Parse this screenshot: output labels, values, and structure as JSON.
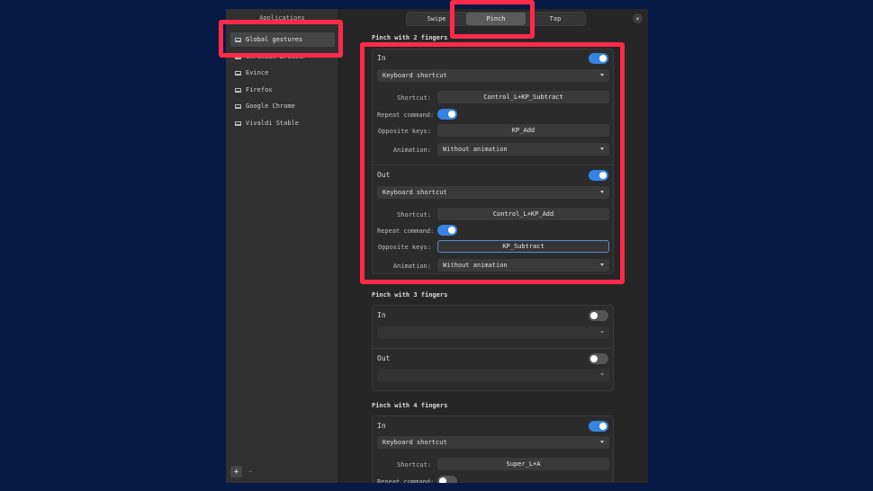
{
  "sidebar": {
    "title": "Applications",
    "items": [
      {
        "label": "Global gestures",
        "selected": true
      },
      {
        "label": "Chromium Browser",
        "selected": false
      },
      {
        "label": "Evince",
        "selected": false
      },
      {
        "label": "Firefox",
        "selected": false
      },
      {
        "label": "Google Chrome",
        "selected": false
      },
      {
        "label": "Vivaldi Stable",
        "selected": false
      }
    ],
    "add_label": "+",
    "remove_label": "−"
  },
  "tabs": [
    {
      "label": "Swipe",
      "active": false
    },
    {
      "label": "Pinch",
      "active": true
    },
    {
      "label": "Tap",
      "active": false
    }
  ],
  "close_label": "×",
  "labels": {
    "shortcut": "Shortcut:",
    "repeat": "Repeat command:",
    "opposite": "Opposite keys:",
    "animation": "Animation:"
  },
  "sections": [
    {
      "title": "Pinch with 2 fingers",
      "in": {
        "label": "In",
        "enabled": true,
        "action": "Keyboard shortcut",
        "shortcut": "Control_L+KP_Subtract",
        "repeat": true,
        "opposite": "KP_Add",
        "animation": "Without animation"
      },
      "out": {
        "label": "Out",
        "enabled": true,
        "action": "Keyboard shortcut",
        "shortcut": "Control_L+KP_Add",
        "repeat": true,
        "opposite": "KP_Subtract",
        "animation": "Without animation"
      }
    },
    {
      "title": "Pinch with 3 fingers",
      "in": {
        "label": "In",
        "enabled": false,
        "action": ""
      },
      "out": {
        "label": "Out",
        "enabled": false,
        "action": ""
      }
    },
    {
      "title": "Pinch with 4 fingers",
      "in": {
        "label": "In",
        "enabled": true,
        "action": "Keyboard shortcut",
        "shortcut": "Super_L+A",
        "repeat": false
      }
    }
  ],
  "colors": {
    "accent": "#3584e4",
    "highlight": "#ff2a4a",
    "background": "#061a45"
  }
}
